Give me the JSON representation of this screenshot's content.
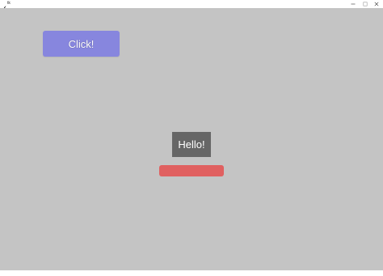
{
  "window": {
    "title": "tk",
    "controls": {
      "minimize_icon": "minimize-icon",
      "maximize_icon": "maximize-icon",
      "close_icon": "close-icon"
    }
  },
  "canvas": {
    "background": "#c4c4c4"
  },
  "click_button": {
    "label": "Click!",
    "color": "#8786de"
  },
  "hello_label": {
    "text": "Hello!",
    "color": "#666666"
  },
  "red_bar": {
    "color": "#e06060"
  }
}
